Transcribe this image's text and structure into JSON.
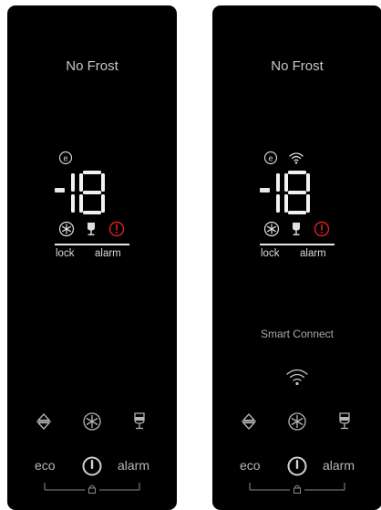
{
  "colors": {
    "panel_bg": "#000000",
    "text": "#c8c8c8",
    "alarm_red": "#e02020",
    "display_white": "#f2f2f2"
  },
  "panels": [
    {
      "title": "No Frost",
      "temperature": "-18",
      "status_icons": [
        "eco-icon",
        "snowflake-icon",
        "wine-glass-icon",
        "alarm-icon"
      ],
      "lock_label": "lock",
      "alarm_label": "alarm",
      "buttons": {
        "eco_label": "eco",
        "alarm_label": "alarm",
        "icons": [
          "up-down-arrows-icon",
          "snowflake-icon",
          "wine-glass-icon",
          "power-icon",
          "lock-icon"
        ]
      }
    },
    {
      "title": "No Frost",
      "temperature": "-18",
      "status_icons": [
        "eco-icon",
        "wifi-icon",
        "snowflake-icon",
        "wine-glass-icon",
        "alarm-icon"
      ],
      "lock_label": "lock",
      "alarm_label": "alarm",
      "smart_connect_label": "Smart Connect",
      "buttons": {
        "eco_label": "eco",
        "alarm_label": "alarm",
        "icons": [
          "up-down-arrows-icon",
          "snowflake-icon",
          "wine-glass-icon",
          "power-icon",
          "lock-icon",
          "wifi-icon"
        ]
      }
    }
  ]
}
